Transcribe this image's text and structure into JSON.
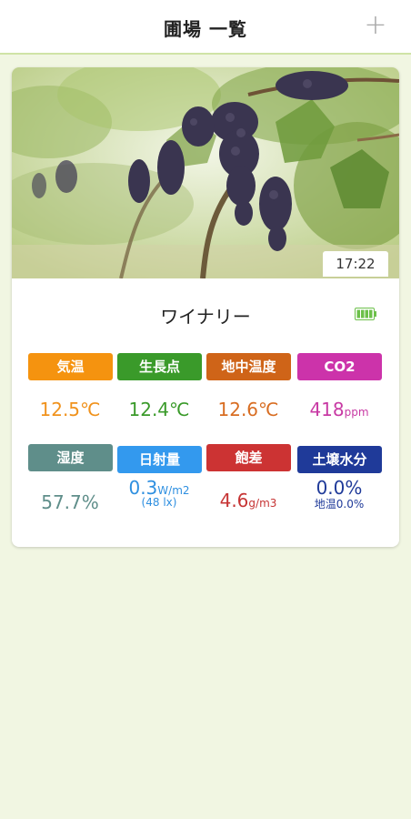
{
  "header": {
    "title": "圃場 一覧",
    "add_label": "+"
  },
  "card": {
    "time": "17:22",
    "site_name": "ワイナリー",
    "metrics": [
      {
        "label": "気温",
        "value": "12.5",
        "unit": "℃",
        "label_color": "#f5930f",
        "value_color": "#f0921c"
      },
      {
        "label": "生長点",
        "value": "12.4",
        "unit": "℃",
        "label_color": "#3a9a2a",
        "value_color": "#3a9a2a"
      },
      {
        "label": "地中温度",
        "value": "12.6",
        "unit": "℃",
        "label_color": "#cf6418",
        "value_color": "#d86d22"
      },
      {
        "label": "CO2",
        "value": "418",
        "unit": "ppm",
        "label_color": "#cc33aa",
        "value_color": "#c83aa4"
      },
      {
        "label": "湿度",
        "value": "57.7",
        "unit": "%",
        "label_color": "#5f8e8a",
        "value_color": "#5f8e8a"
      },
      {
        "label": "日射量",
        "value": "0.3",
        "unit": "W/m2",
        "sub": "(48 lx)",
        "label_color": "#3399ee",
        "value_color": "#2e8fe0"
      },
      {
        "label": "飽差",
        "value": "4.6",
        "unit": "g/m3",
        "label_color": "#cc3333",
        "value_color": "#c63434"
      },
      {
        "label": "土壌水分",
        "value": "0.0",
        "unit": "%",
        "sub": "地温0.0%",
        "label_color": "#1f3a99",
        "value_color": "#1f3a99"
      }
    ]
  }
}
